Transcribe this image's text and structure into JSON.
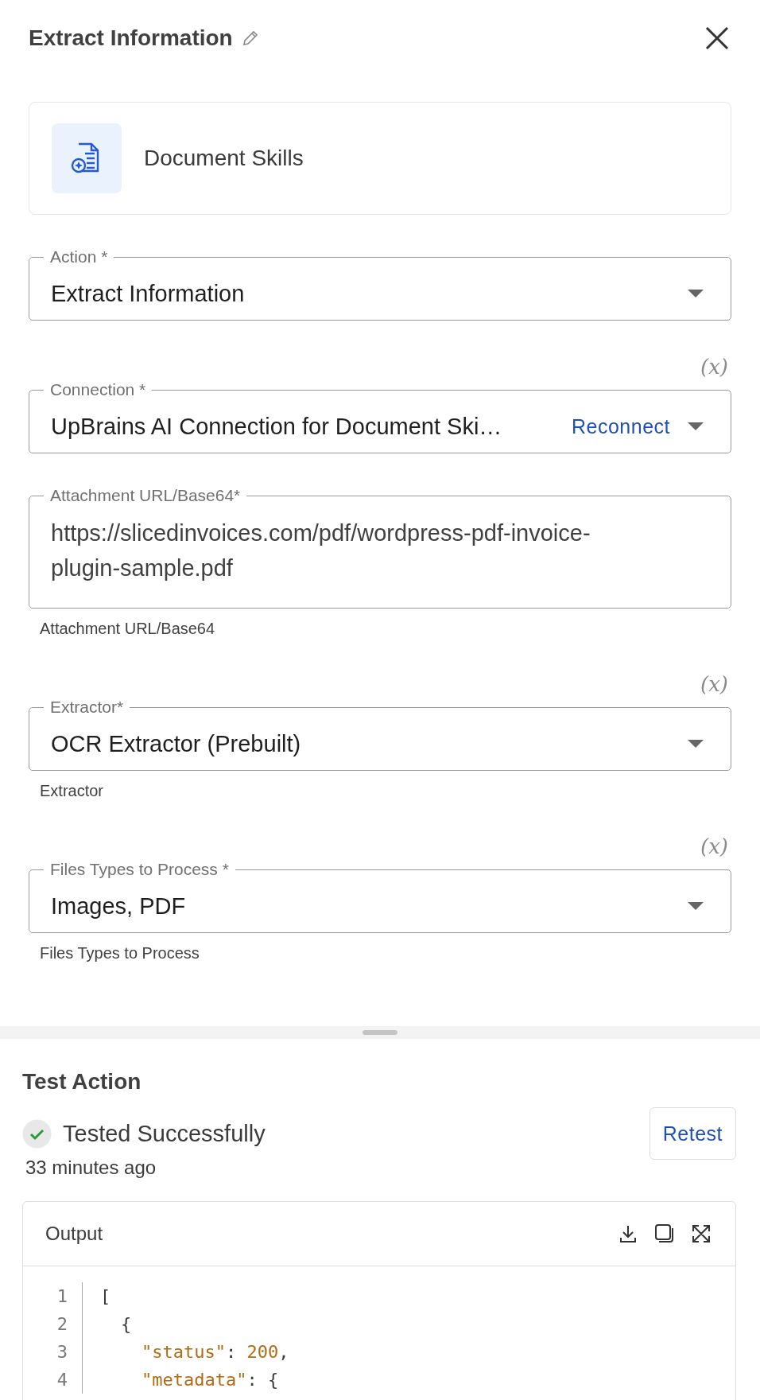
{
  "header": {
    "title": "Extract Information"
  },
  "piece": {
    "name": "Document Skills"
  },
  "fields": [
    {
      "kind": "select",
      "label": "Action *",
      "value": "Extract Information"
    },
    {
      "kind": "select",
      "label": "Connection *",
      "value": "UpBrains AI Connection for Document Ski…",
      "link": "Reconnect",
      "variable_label": "(x)"
    },
    {
      "kind": "text",
      "label": "Attachment URL/Base64*",
      "value": "https://slicedinvoices.com/pdf/wordpress-pdf-invoice-plugin-sample.pdf",
      "helper": "Attachment URL/Base64"
    },
    {
      "kind": "select",
      "label": "Extractor*",
      "value": "OCR Extractor (Prebuilt)",
      "helper": "Extractor",
      "variable_label": "(x)"
    },
    {
      "kind": "select",
      "label": "Files Types to Process *",
      "value": "Images, PDF",
      "helper": "Files Types to Process",
      "variable_label": "(x)"
    }
  ],
  "test": {
    "title": "Test Action",
    "status": "Tested Successfully",
    "success": true,
    "time": "33 minutes ago",
    "button": "Retest"
  },
  "output": {
    "title": "Output",
    "lines": [
      {
        "number": "1",
        "parts": [
          {
            "kind": "punct",
            "text": "["
          }
        ],
        "children": [
          {
            "number": "2",
            "parts": [
              {
                "kind": "punct",
                "text": "{"
              }
            ],
            "children": [
              {
                "number": "3",
                "parts": [
                  {
                    "kind": "key",
                    "text": "\"status\""
                  },
                  {
                    "kind": "punct",
                    "text": ": "
                  },
                  {
                    "kind": "number",
                    "text": "200"
                  },
                  {
                    "kind": "punct",
                    "text": ","
                  }
                ]
              },
              {
                "number": "4",
                "parts": [
                  {
                    "kind": "key",
                    "text": "\"metadata\""
                  },
                  {
                    "kind": "punct",
                    "text": ": {"
                  }
                ]
              }
            ]
          }
        ]
      }
    ]
  }
}
